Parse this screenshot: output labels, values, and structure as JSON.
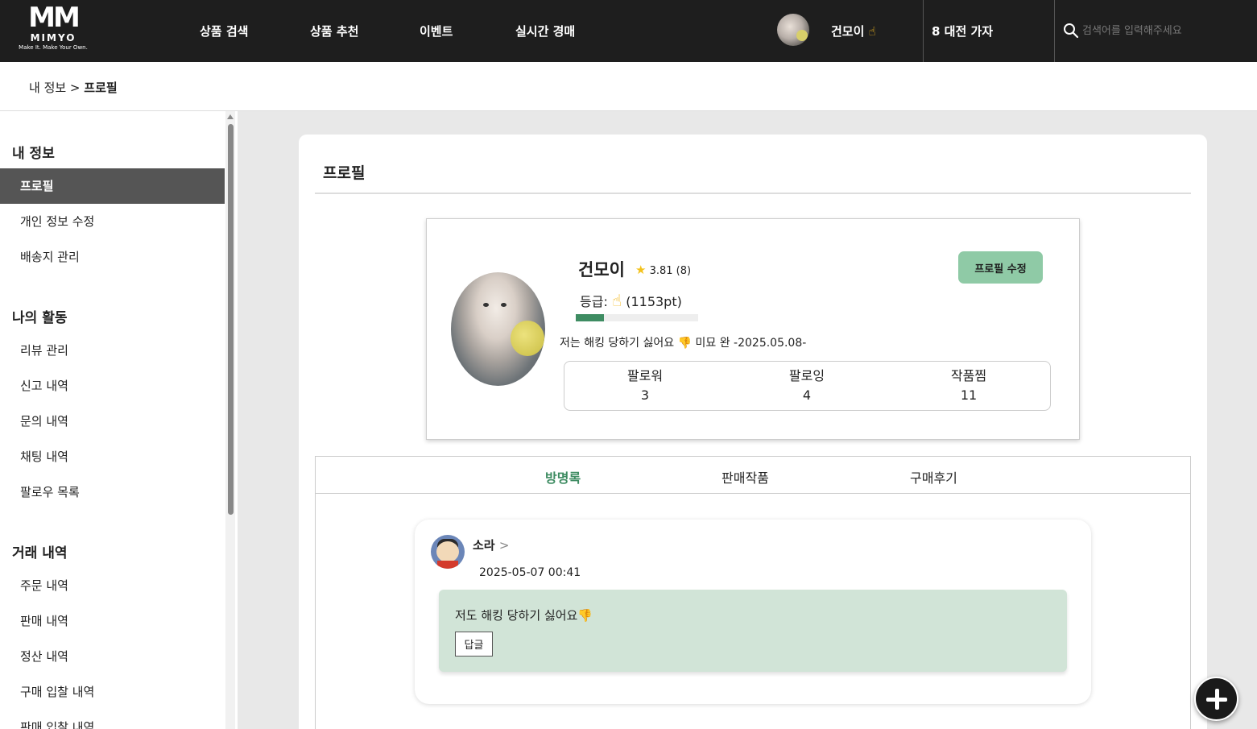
{
  "header": {
    "logo_mark": "MM",
    "logo_name": "MIMYO",
    "logo_tagline": "Make It. Make Your Own.",
    "nav": [
      "상품 검색",
      "상품 추천",
      "이벤트",
      "실시간 경매"
    ],
    "user_name": "건모이",
    "user_badge": "☝",
    "group_label": "8 대전 가자",
    "search_placeholder": "검색어를 입력해주세요"
  },
  "breadcrumb": {
    "parent": "내 정보 >",
    "current": "프로필"
  },
  "sidebar": {
    "sections": [
      {
        "title": "내 정보",
        "items": [
          "프로필",
          "개인 정보 수정",
          "배송지 관리"
        ]
      },
      {
        "title": "나의 활동",
        "items": [
          "리뷰 관리",
          "신고 내역",
          "문의 내역",
          "채팅 내역",
          "팔로우 목록"
        ]
      },
      {
        "title": "거래 내역",
        "items": [
          "주문 내역",
          "판매 내역",
          "정산 내역",
          "구매 입찰 내역",
          "판매 입찰 내역"
        ]
      }
    ],
    "active_item": "프로필"
  },
  "page": {
    "title": "프로필"
  },
  "profile": {
    "name": "건모이",
    "rating_star": "★",
    "rating": "3.81 (8)",
    "grade_label": "등급:",
    "grade_icon": "☝",
    "grade_points": "(1153pt)",
    "grade_progress": 0.23,
    "bio_prefix": "저는 해킹 당하기 싫어요",
    "bio_icon": "👎",
    "bio_suffix": "미묘 완 -2025.05.08-",
    "edit_label": "프로필 수정",
    "stats": [
      {
        "label": "팔로워",
        "value": "3"
      },
      {
        "label": "팔로잉",
        "value": "4"
      },
      {
        "label": "작품찜",
        "value": "11"
      }
    ]
  },
  "tabs": {
    "items": [
      "방명록",
      "판매작품",
      "구매후기"
    ],
    "active": "방명록"
  },
  "guestbook": {
    "entries": [
      {
        "author": "소라",
        "arrow": ">",
        "date": "2025-05-07 00:41",
        "message": "저도 해킹 당하기 싫어요",
        "message_icon": "👎",
        "reply_label": "답글"
      }
    ]
  },
  "colors": {
    "accent_green": "#3e8c62",
    "button_green": "#8fcaa6",
    "message_bg": "#d1e4d7",
    "topbar": "#1e1e1e"
  }
}
